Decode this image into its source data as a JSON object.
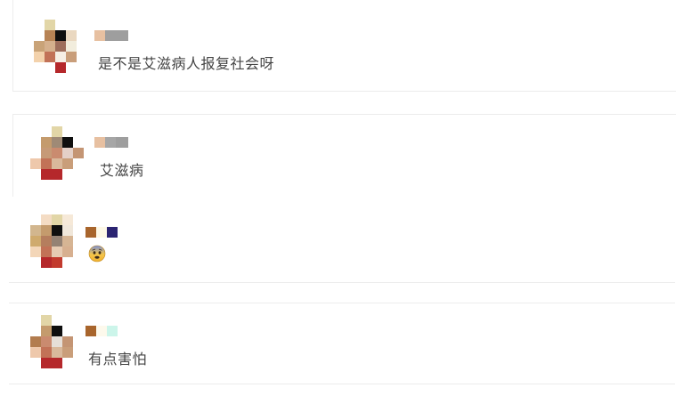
{
  "comments": [
    {
      "text": "是不是艾滋病人报复社会呀"
    },
    {
      "text": "艾滋病"
    },
    {
      "text": ""
    },
    {
      "text": "有点害怕"
    }
  ],
  "colors": {
    "text": "#444444",
    "divider": "#ececec",
    "background": "#ffffff"
  },
  "icons": {
    "avatar": "avatar",
    "reaction": "fearful-face-icon"
  }
}
